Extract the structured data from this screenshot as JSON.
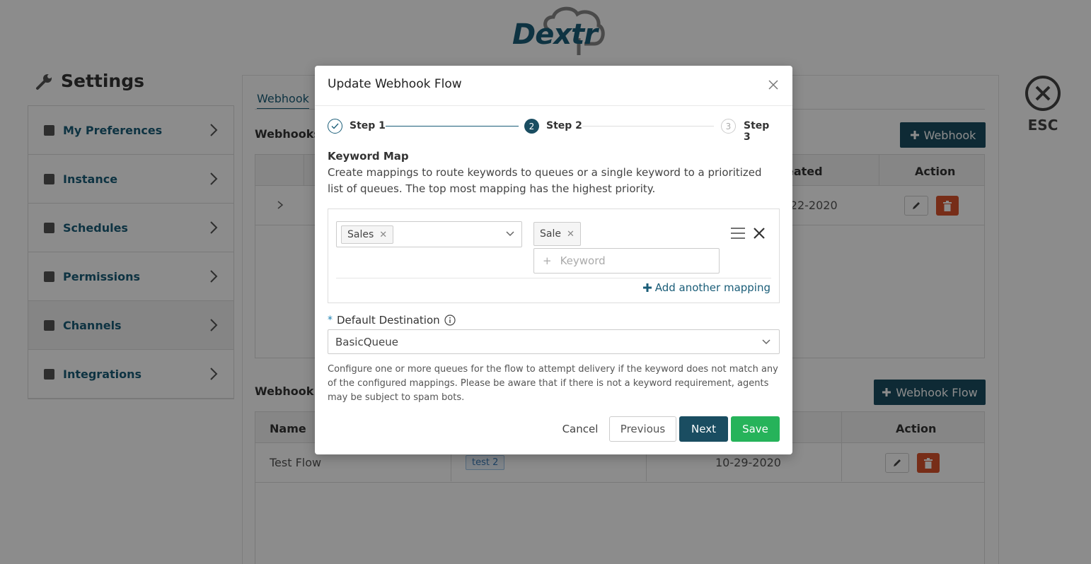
{
  "brand": {
    "logo_text": "Dextr"
  },
  "settings": {
    "title": "Settings",
    "sidebar": [
      {
        "label": "My Preferences"
      },
      {
        "label": "Instance"
      },
      {
        "label": "Schedules"
      },
      {
        "label": "Permissions"
      },
      {
        "label": "Channels",
        "active": true
      },
      {
        "label": "Integrations"
      }
    ]
  },
  "page": {
    "tab": "Webhook",
    "webhooks_title": "Webhooks:",
    "add_webhook_label": "Webhook",
    "webhooks_table": {
      "headers": {
        "created": "eated",
        "action": "Action"
      },
      "row": {
        "created": "-22-2020"
      }
    },
    "flows_title": "Webhook F",
    "add_flow_label": "Webhook Flow",
    "flows_table": {
      "headers": {
        "name": "Name",
        "action": "Action"
      },
      "row": {
        "name": "Test Flow",
        "tag": "test 2",
        "created": "10-29-2020"
      }
    },
    "esc_label": "ESC"
  },
  "modal": {
    "title": "Update Webhook Flow",
    "steps": [
      {
        "label": "Step 1",
        "state": "done"
      },
      {
        "label": "Step 2",
        "number": "2",
        "state": "active"
      },
      {
        "label": "Step 3",
        "number": "3",
        "state": "pending"
      }
    ],
    "keyword_map": {
      "title": "Keyword Map",
      "description": "Create mappings to route keywords to queues or a single keyword to a prioritized list of queues. The top most mapping has the highest priority.",
      "mapping": {
        "queue_chip": "Sales",
        "keyword_chip": "Sale",
        "keyword_placeholder": "Keyword"
      },
      "add_mapping_label": "Add another mapping"
    },
    "default_destination": {
      "required_mark": "*",
      "label": "Default Destination",
      "value": "BasicQueue",
      "help": "Configure one or more queues for the flow to attempt delivery if the keyword does not match any of the configured mappings. Please be aware that if there is not a keyword requirement, agents may be subject to spam bots."
    },
    "buttons": {
      "cancel": "Cancel",
      "previous": "Previous",
      "next": "Next",
      "save": "Save"
    }
  },
  "colors": {
    "brand": "#1a5d78",
    "primary_button": "#1a4d61",
    "save_button": "#26b35a",
    "delete_button": "#d9532c"
  }
}
